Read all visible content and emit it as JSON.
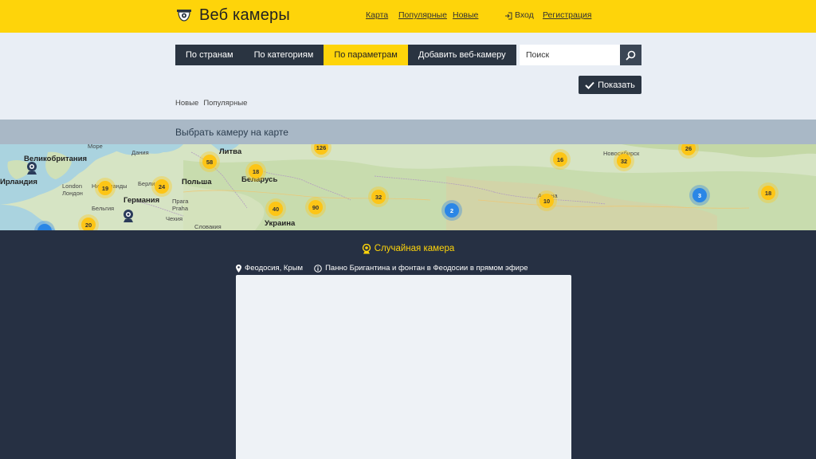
{
  "header": {
    "logo_text": "Веб камеры",
    "links": {
      "map": "Карта",
      "popular": "Популярные",
      "new": "Новые"
    },
    "login": "Вход",
    "register": "Регистрация"
  },
  "nav": {
    "tabs": [
      "По странам",
      "По категориям",
      "По параметрам",
      "Добавить веб-камеру"
    ],
    "active_index": 2
  },
  "search": {
    "placeholder": "Поиск"
  },
  "show_button": "Показать",
  "breadcrumbs": [
    "Новые",
    "Популярные"
  ],
  "map_section": {
    "title": "Выбрать камеру на карте",
    "labels": {
      "uk": "Великобритания",
      "ireland": "Ирландия",
      "denmark": "Дания",
      "lithuania": "Литва",
      "netherlands": "Нидерланды",
      "berlin": "Берлин",
      "london": "London",
      "london_ru": "Лондон",
      "germany": "Германия",
      "poland": "Польша",
      "belarus": "Беларусь",
      "belgium": "Бельгия",
      "prague": "Прага",
      "praha": "Praha",
      "czech": "Чехия",
      "slovakia": "Словакия",
      "ukraine": "Украина",
      "novosibirsk": "Новосибирск",
      "astana": "Астана",
      "more": "Море"
    },
    "clusters": [
      {
        "count": "19",
        "color": "yellow"
      },
      {
        "count": "58",
        "color": "yellow"
      },
      {
        "count": "18",
        "color": "yellow"
      },
      {
        "count": "24",
        "color": "yellow"
      },
      {
        "count": "20",
        "color": "yellow"
      },
      {
        "count": "40",
        "color": "yellow"
      },
      {
        "count": "90",
        "color": "yellow"
      },
      {
        "count": "32",
        "color": "yellow"
      },
      {
        "count": "2",
        "color": "blue"
      },
      {
        "count": "10",
        "color": "yellow"
      },
      {
        "count": "16",
        "color": "yellow"
      },
      {
        "count": "32",
        "color": "yellow"
      },
      {
        "count": "26",
        "color": "yellow"
      },
      {
        "count": "3",
        "color": "blue"
      },
      {
        "count": "18",
        "color": "yellow"
      },
      {
        "count": "126",
        "color": "yellow"
      }
    ]
  },
  "random_camera": {
    "title": "Случайная камера",
    "location": "Феодосия, Крым",
    "description": "Панно Бригантина и фонтан в Феодосии в прямом эфире"
  },
  "colors": {
    "brand_yellow": "#fed40a",
    "dark_navy": "#263043",
    "nav_dark": "#2a3441",
    "page_bg": "#e9eef5"
  }
}
